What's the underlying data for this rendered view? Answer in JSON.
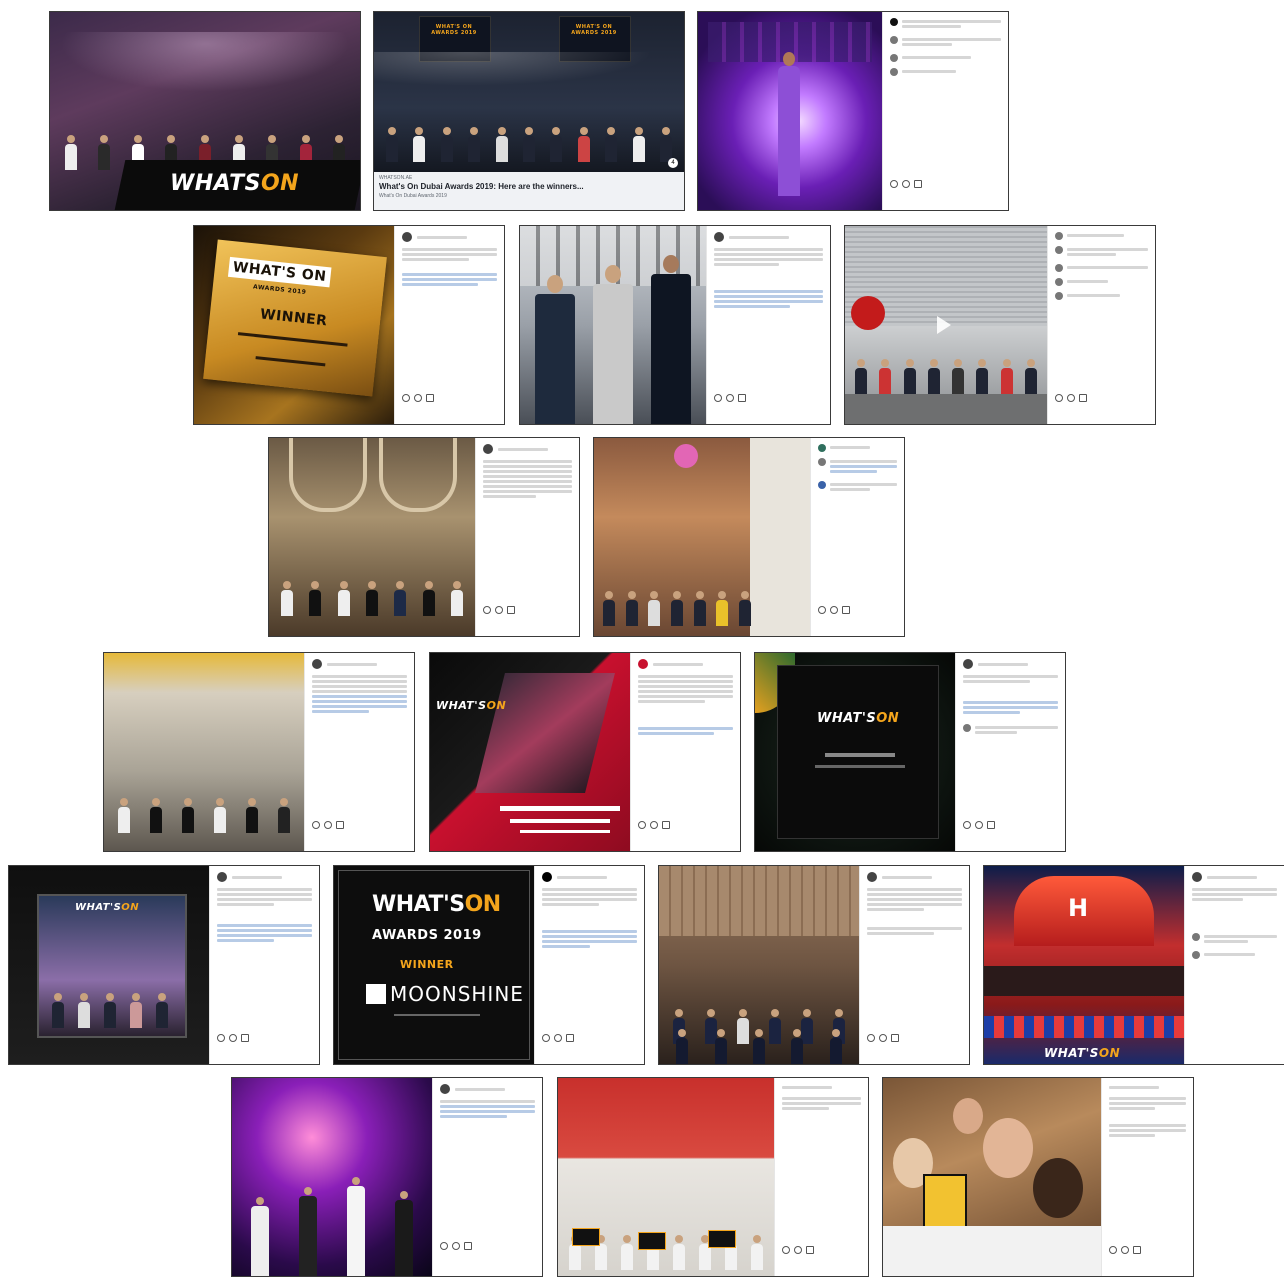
{
  "collage": {
    "c1": {
      "logo_text": "WHATS",
      "logo_accent": "ON"
    },
    "c2": {
      "banner_left": "WHAT'S ON AWARDS 2019",
      "banner_right": "WHAT'S ON AWARDS 2019",
      "source": "WHATSON.AE",
      "headline": "What's On Dubai Awards 2019: Here are the winners...",
      "sub": "What's On Dubai Awards 2019",
      "badge": "4"
    },
    "c13": {
      "logo_main": "WHAT'S",
      "logo_accent": "ON",
      "awards": "AWARDS 2019",
      "winner": "WINNER",
      "brand": "MOONSHINE"
    },
    "c4": {
      "plaque_logo": "WHAT'S ON",
      "plaque_sub": "AWARDS 2019",
      "winner": "WINNER"
    }
  },
  "colors": {
    "accent": "#f4a51c",
    "link": "#3897f0",
    "dark": "#111111",
    "red": "#c8102e"
  }
}
